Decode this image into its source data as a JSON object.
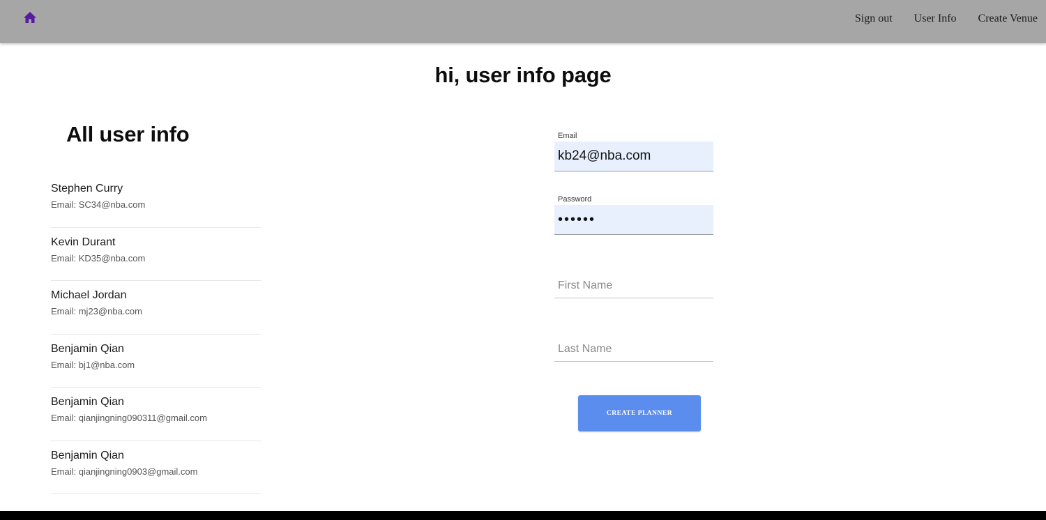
{
  "nav": {
    "home_icon": "home-icon",
    "links": [
      "Sign out",
      "User Info",
      "Create Venue"
    ]
  },
  "page": {
    "title": "hi, user info page",
    "section_title": "All user info"
  },
  "users": [
    {
      "name": "Stephen Curry",
      "email": "Email: SC34@nba.com"
    },
    {
      "name": "Kevin Durant",
      "email": "Email: KD35@nba.com"
    },
    {
      "name": "Michael Jordan",
      "email": "Email: mj23@nba.com"
    },
    {
      "name": "Benjamin Qian",
      "email": "Email: bj1@nba.com"
    },
    {
      "name": "Benjamin Qian",
      "email": "Email: qianjingning090311@gmail.com"
    },
    {
      "name": "Benjamin Qian",
      "email": "Email: qianjingning0903@gmail.com"
    }
  ],
  "form": {
    "email_label": "Email",
    "email_value": "kb24@nba.com",
    "password_label": "Password",
    "password_value": "••••••",
    "first_name_placeholder": "First Name",
    "last_name_placeholder": "Last Name",
    "submit_label": "CREATE PLANNER"
  },
  "colors": {
    "topbar": "#a6a6a6",
    "home_icon": "#5a1aa0",
    "autofill": "#e8f0fe",
    "button": "#5b8dee"
  }
}
